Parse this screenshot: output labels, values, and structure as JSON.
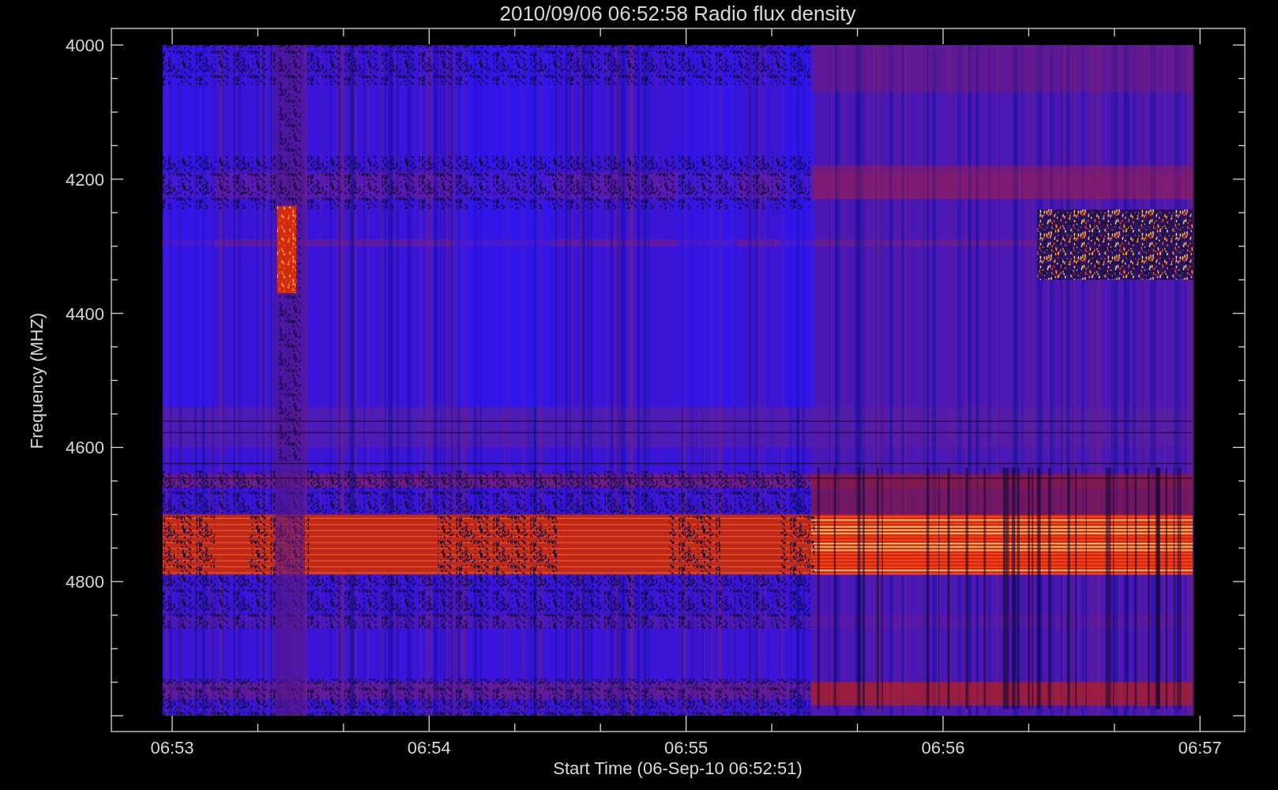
{
  "plot": {
    "title": "2010/09/06 06:52:58 Radio flux density",
    "ylabel": "Frequency (MHZ)",
    "xlabel": "Start Time (06-Sep-10 06:52:51)",
    "y_tick_labels": [
      "4000",
      "4200",
      "4400",
      "4600",
      "4800"
    ],
    "x_tick_labels": [
      "06:53",
      "06:54",
      "06:55",
      "06:56",
      "06:57"
    ]
  }
}
